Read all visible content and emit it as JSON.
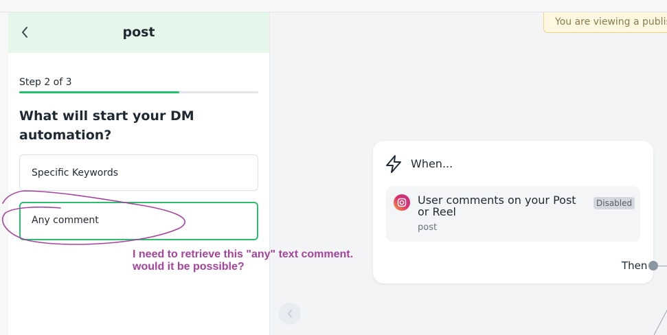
{
  "banner": {
    "text": "You are viewing a publish"
  },
  "panel": {
    "title": "post",
    "step_label": "Step 2 of 3",
    "progress": 0.67,
    "question": "What will start your DM automation?",
    "options": [
      {
        "label": "Specific Keywords",
        "selected": false
      },
      {
        "label": "Any comment",
        "selected": true
      }
    ]
  },
  "annotation": {
    "line1": "I need to retrieve this \"any\" text comment.",
    "line2": "would it be possible?",
    "color": "#a3439c"
  },
  "node": {
    "when_label": "When...",
    "trigger": {
      "title": "User comments on your Post or Reel",
      "subtitle": "post",
      "badge": "Disabled"
    },
    "then_label": "Then"
  },
  "colors": {
    "accent": "#1fbf6b",
    "header_bg": "#e4f7ea",
    "banner_bg": "#fff8e1"
  }
}
